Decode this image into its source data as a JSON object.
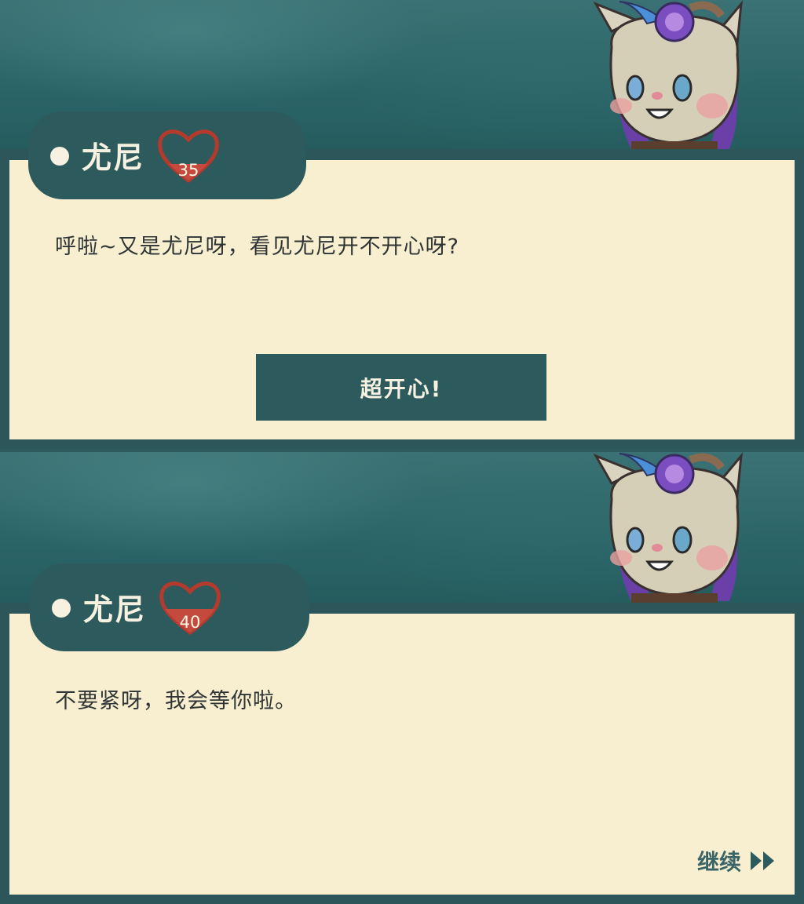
{
  "dialogs": [
    {
      "speaker": "尤尼",
      "affection": "35",
      "affection_fill": 0.35,
      "text": "呼啦~又是尤尼呀，看见尤尼开不开心呀?",
      "choice": "超开心!"
    },
    {
      "speaker": "尤尼",
      "affection": "40",
      "affection_fill": 0.4,
      "text": "不要紧呀，我会等你啦。",
      "continue_label": "继续"
    }
  ],
  "icons": {
    "portrait": "unicorn-cat-portrait-icon",
    "affection": "heart-icon",
    "continue": "fast-forward-icon",
    "bullet": "dot-icon"
  },
  "colors": {
    "frame": "#2c5659",
    "paper": "#f8eed0",
    "heart": "#b53a2e",
    "text": "#2f3535"
  }
}
